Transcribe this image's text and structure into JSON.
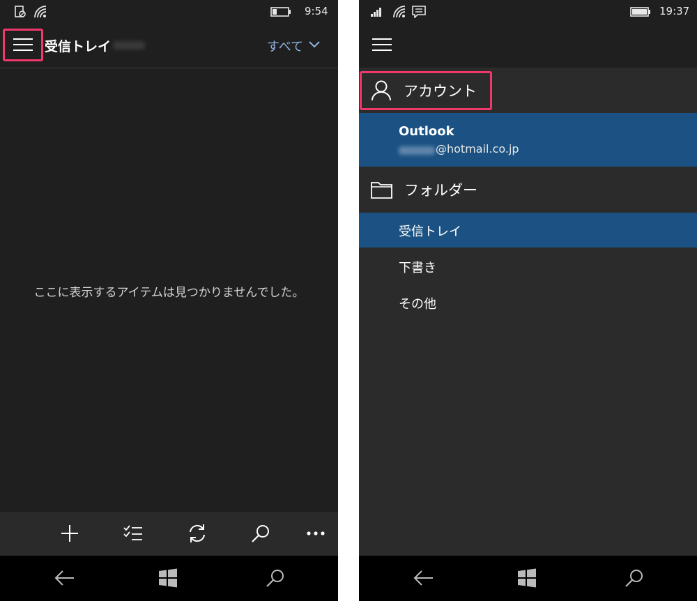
{
  "left": {
    "status": {
      "time": "9:54"
    },
    "header": {
      "title": "受信トレイ",
      "filter_label": "すべて"
    },
    "empty_message": "ここに表示するアイテムは見つかりませんでした。",
    "appbar": [
      "add-icon",
      "select-icon",
      "sync-icon",
      "search-icon",
      "more-icon"
    ]
  },
  "right": {
    "status": {
      "time": "19:37"
    },
    "account_section": {
      "label": "アカウント"
    },
    "account": {
      "name": "Outlook",
      "email_suffix": "@hotmail.co.jp"
    },
    "folder_section": {
      "label": "フォルダー"
    },
    "folders": [
      {
        "label": "受信トレイ",
        "selected": true
      },
      {
        "label": "下書き",
        "selected": false
      },
      {
        "label": "その他",
        "selected": false
      }
    ]
  },
  "colors": {
    "highlight": "#f0386b",
    "selection": "#1b5283",
    "accent_text": "#8fb5dd"
  }
}
